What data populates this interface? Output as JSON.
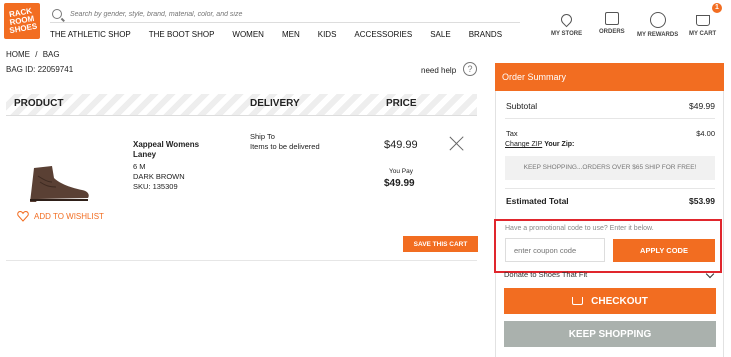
{
  "logo": {
    "text": "RACK ROOM SHOES"
  },
  "search": {
    "placeholder": "Search by gender, style, brand, material, color, and size"
  },
  "nav": [
    "THE ATHLETIC SHOP",
    "THE BOOT SHOP",
    "WOMEN",
    "MEN",
    "KIDS",
    "ACCESSORIES",
    "SALE",
    "BRANDS"
  ],
  "utility": {
    "my_store": "MY STORE",
    "orders": "ORDERS",
    "my_rewards": "MY REWARDS",
    "my_cart": "MY CART",
    "cart_count": "1"
  },
  "breadcrumb": {
    "home": "HOME",
    "sep": "/",
    "bag": "BAG"
  },
  "bag_id": "BAG ID: 22059741",
  "need_help": "need help",
  "table_headers": {
    "product": "PRODUCT",
    "delivery": "DELIVERY",
    "price": "PRICE"
  },
  "item": {
    "name": "Xappeal Womens Laney",
    "size": "6  M",
    "color": "DARK BROWN",
    "sku": "SKU: 135309",
    "delivery_line1": "Ship To",
    "delivery_line2": "Items to be delivered",
    "price": "$49.99",
    "you_pay_label": "You Pay",
    "you_pay": "$49.99"
  },
  "wishlist_label": "ADD TO WISHLIST",
  "save_cart_label": "SAVE THIS CART",
  "summary": {
    "title": "Order Summary",
    "subtotal_label": "Subtotal",
    "subtotal": "$49.99",
    "tax_label": "Tax",
    "tax": "$4.00",
    "change_zip": "Change ZIP",
    "your_zip": "Your Zip:",
    "ship_banner": "KEEP SHOPPING...ORDERS OVER $65 SHIP FOR FREE!",
    "estimated_total_label": "Estimated Total",
    "estimated_total": "$53.99"
  },
  "promo": {
    "prompt": "Have a promotional code to use? Enter it below.",
    "placeholder": "enter coupon code",
    "apply_label": "APPLY CODE"
  },
  "donate_label": "Donate to Shoes That Fit",
  "checkout_label": "CHECKOUT",
  "keep_shopping_label": "KEEP SHOPPING",
  "colors": {
    "accent": "#f26d21",
    "highlight": "#e0262d",
    "muted_button": "#aab1ad"
  }
}
